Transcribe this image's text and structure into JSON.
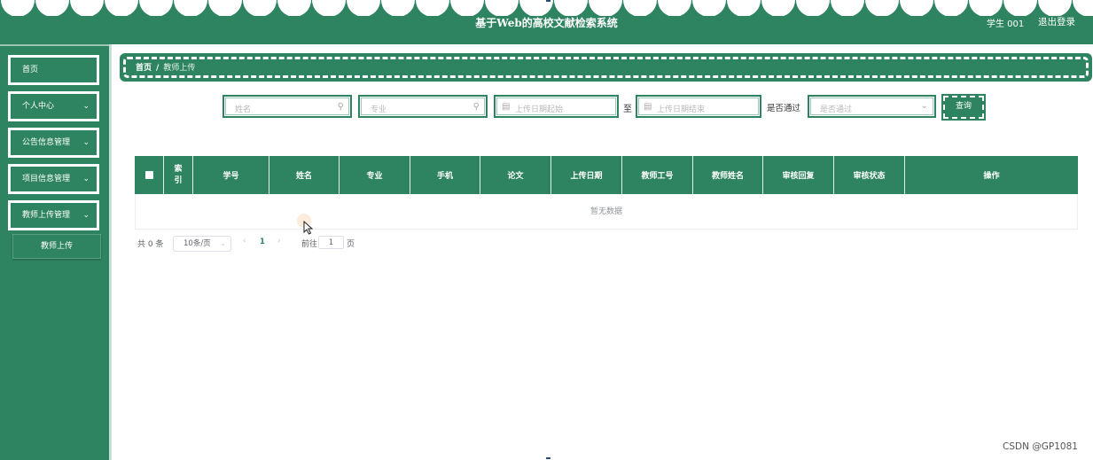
{
  "header": {
    "title": "基于Web的高校文献检索系统",
    "user_label": "学生  001",
    "logout_label": "退出登录"
  },
  "sidebar": {
    "items": [
      {
        "label": "首页",
        "has_chevron": false
      },
      {
        "label": "个人中心",
        "has_chevron": true
      },
      {
        "label": "公告信息管理",
        "has_chevron": true
      },
      {
        "label": "项目信息管理",
        "has_chevron": true
      },
      {
        "label": "教师上传管理",
        "has_chevron": true
      }
    ],
    "sub_item": "教师上传"
  },
  "breadcrumb": {
    "home": "首页",
    "separator": "/",
    "current": "教师上传"
  },
  "search": {
    "name_placeholder": "姓名",
    "major_placeholder": "专业",
    "start_date_placeholder": "上传日期起始",
    "to_label": "至",
    "end_date_placeholder": "上传日期结束",
    "approved_label": "是否通过",
    "approved_placeholder": "是否通过",
    "query_button": "查询"
  },
  "table": {
    "index_header": "索引",
    "columns": [
      "学号",
      "姓名",
      "专业",
      "手机",
      "论文",
      "上传日期",
      "教师工号",
      "教师姓名",
      "审核回复",
      "审核状态",
      "操作"
    ],
    "empty_text": "暂无数据"
  },
  "pagination": {
    "total": "共 0 条",
    "page_size": "10条/页",
    "current_page": "1",
    "goto_label": "前往",
    "goto_value": "1",
    "page_suffix": "页"
  },
  "watermark": "CSDN @GP1081",
  "colors": {
    "primary": "#2e8460",
    "text_light": "#ffffff"
  }
}
